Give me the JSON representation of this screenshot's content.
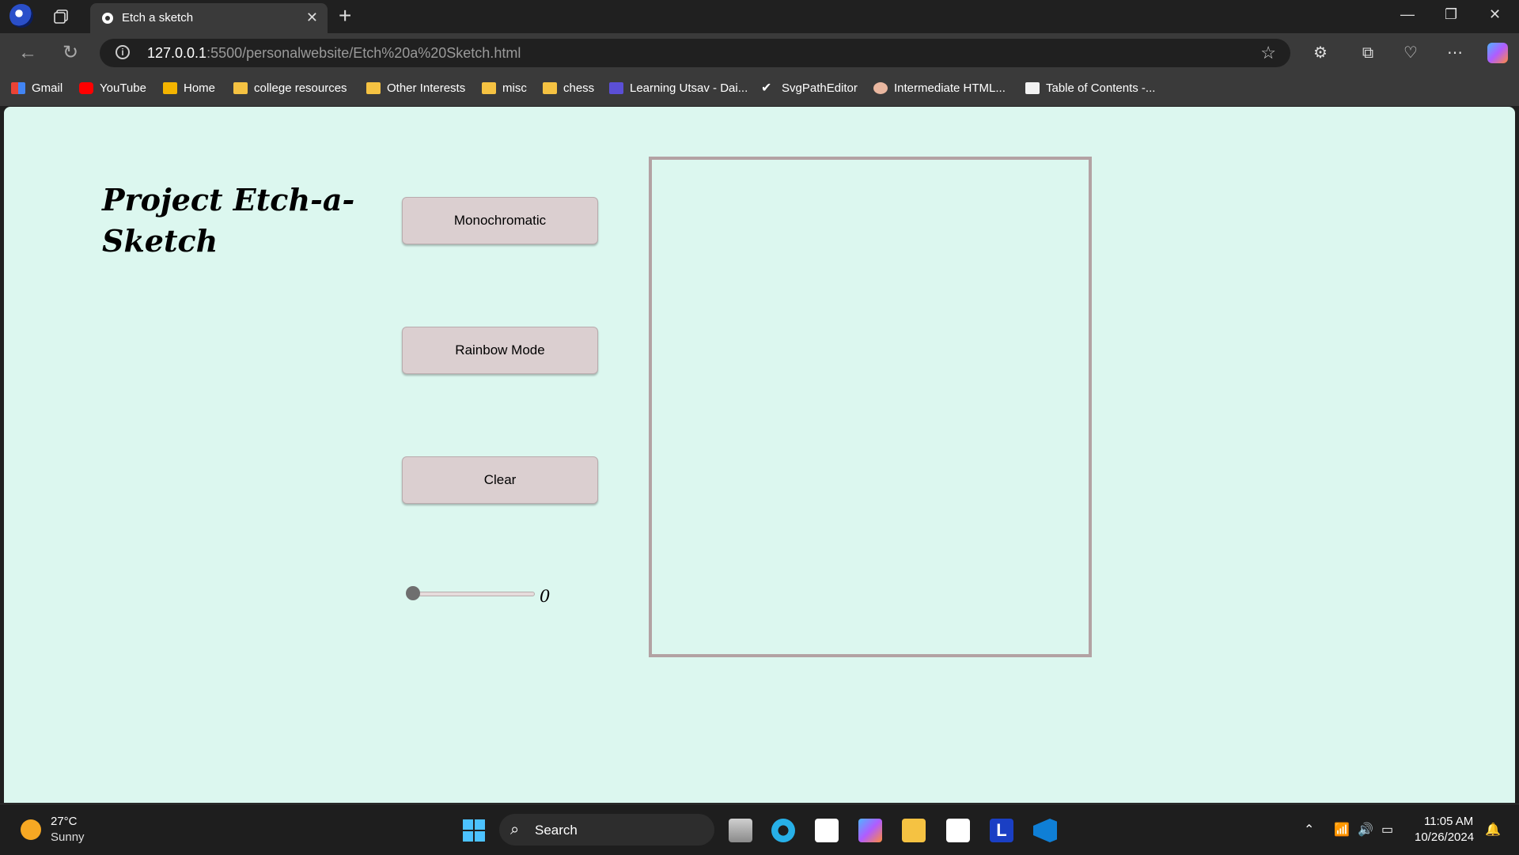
{
  "browser": {
    "tab_title": "Etch a sketch",
    "url_host": "127.0.0.1",
    "url_path": ":5500/personalwebsite/Etch%20a%20Sketch.html",
    "bookmarks": [
      {
        "label": "Gmail",
        "icon": "gmail-icon"
      },
      {
        "label": "YouTube",
        "icon": "youtube-icon"
      },
      {
        "label": "Home",
        "icon": "home-icon"
      },
      {
        "label": "college resources",
        "icon": "folder-icon"
      },
      {
        "label": "Other Interests",
        "icon": "folder-icon"
      },
      {
        "label": "misc",
        "icon": "folder-icon"
      },
      {
        "label": "chess",
        "icon": "folder-icon"
      },
      {
        "label": "Learning Utsav - Dai...",
        "icon": "list-icon"
      },
      {
        "label": "SvgPathEditor",
        "icon": "check-icon"
      },
      {
        "label": "Intermediate HTML...",
        "icon": "owl-icon"
      },
      {
        "label": "Table of Contents -...",
        "icon": "page-icon"
      }
    ]
  },
  "page": {
    "title": "Project Etch-a-Sketch",
    "buttons": {
      "mono": "Monochromatic",
      "rainbow": "Rainbow Mode",
      "clear": "Clear"
    },
    "slider_value": "0",
    "slider_fraction": 0,
    "colors": {
      "background": "#dcf7ef",
      "button": "#dbcfd0",
      "canvas_border": "#b3a2a3"
    }
  },
  "taskbar": {
    "weather_temp": "27°C",
    "weather_desc": "Sunny",
    "search_label": "Search",
    "time": "11:05 AM",
    "date": "10/26/2024"
  }
}
